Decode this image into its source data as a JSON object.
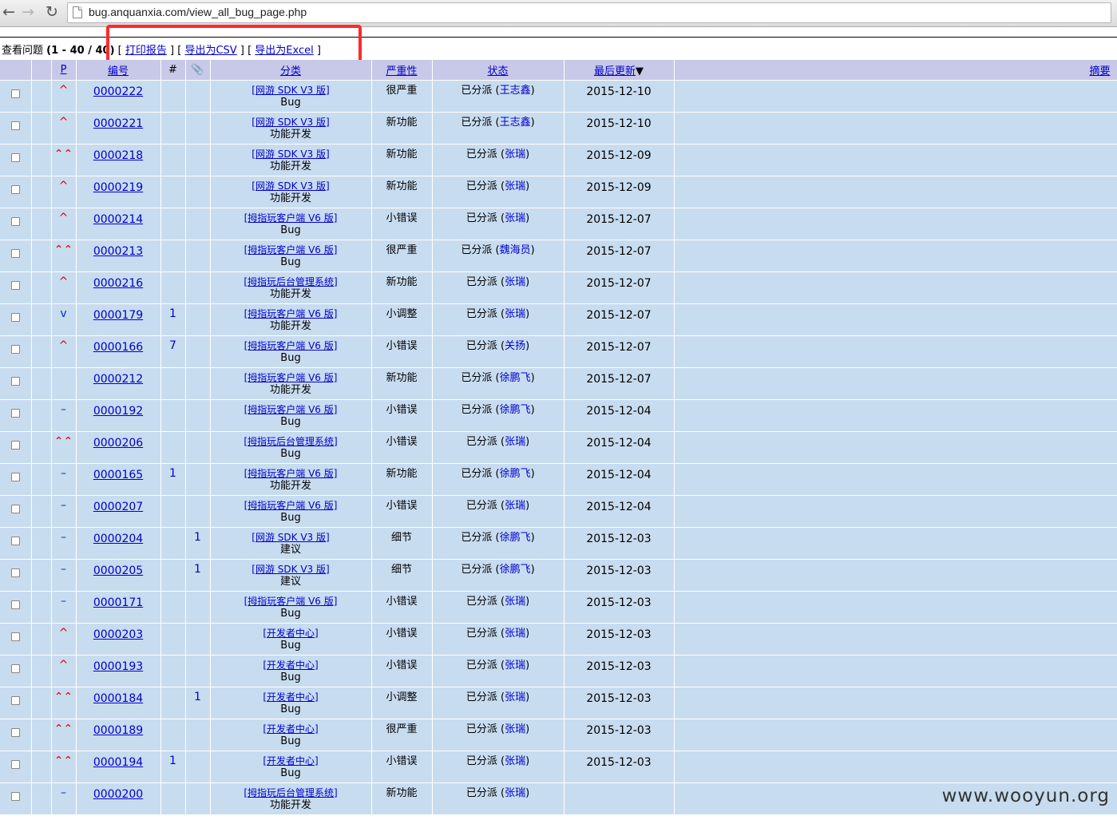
{
  "browser": {
    "url": "bug.anquanxia.com/view_all_bug_page.php",
    "back_icon": "back-arrow-icon",
    "forward_icon": "forward-arrow-icon",
    "reload_icon": "reload-icon"
  },
  "toolbar": {
    "label": "查看问题",
    "range": "(1 - 40 / 40)",
    "print": "打印报告",
    "csv": "导出为CSV",
    "excel": "导出为Excel",
    "bracket_open": "[",
    "bracket_close": "]"
  },
  "columns": {
    "p": "P",
    "id": "编号",
    "notes": "#",
    "attach": "📎",
    "category": "分类",
    "severity": "严重性",
    "status": "状态",
    "updated": "最后更新",
    "summary": "摘要"
  },
  "rows": [
    {
      "prio": "^",
      "id": "0000222",
      "notes": "",
      "attach": "",
      "cat": "[网游 SDK V3 版]",
      "sub": "Bug",
      "sev": "很严重",
      "st": "已分派",
      "who": "王志鑫",
      "date": "2015-12-10",
      "summary": ""
    },
    {
      "prio": "^",
      "id": "0000221",
      "notes": "",
      "attach": "",
      "cat": "[网游 SDK V3 版]",
      "sub": "功能开发",
      "sev": "新功能",
      "st": "已分派",
      "who": "王志鑫",
      "date": "2015-12-10",
      "summary": ""
    },
    {
      "prio": "⌃⌃",
      "id": "0000218",
      "notes": "",
      "attach": "",
      "cat": "[网游 SDK V3 版]",
      "sub": "功能开发",
      "sev": "新功能",
      "st": "已分派",
      "who": "张瑞",
      "date": "2015-12-09",
      "summary": ""
    },
    {
      "prio": "^",
      "id": "0000219",
      "notes": "",
      "attach": "",
      "cat": "[网游 SDK V3 版]",
      "sub": "功能开发",
      "sev": "新功能",
      "st": "已分派",
      "who": "张瑞",
      "date": "2015-12-09",
      "summary": ""
    },
    {
      "prio": "^",
      "id": "0000214",
      "notes": "",
      "attach": "",
      "cat": "[拇指玩客户端 V6 版]",
      "sub": "Bug",
      "sev": "小错误",
      "st": "已分派",
      "who": "张瑞",
      "date": "2015-12-07",
      "summary": ""
    },
    {
      "prio": "⌃⌃",
      "id": "0000213",
      "notes": "",
      "attach": "",
      "cat": "[拇指玩客户端 V6 版]",
      "sub": "Bug",
      "sev": "很严重",
      "st": "已分派",
      "who": "魏海员",
      "date": "2015-12-07",
      "summary": ""
    },
    {
      "prio": "^",
      "id": "0000216",
      "notes": "",
      "attach": "",
      "cat": "[拇指玩后台管理系统]",
      "sub": "功能开发",
      "sev": "新功能",
      "st": "已分派",
      "who": "张瑞",
      "date": "2015-12-07",
      "summary": ""
    },
    {
      "prio": "v",
      "id": "0000179",
      "notes": "1",
      "attach": "",
      "cat": "[拇指玩客户端 V6 版]",
      "sub": "功能开发",
      "sev": "小调整",
      "st": "已分派",
      "who": "张瑞",
      "date": "2015-12-07",
      "summary": ""
    },
    {
      "prio": "^",
      "id": "0000166",
      "notes": "7",
      "attach": "",
      "cat": "[拇指玩客户端 V6 版]",
      "sub": "Bug",
      "sev": "小错误",
      "st": "已分派",
      "who": "关扬",
      "date": "2015-12-07",
      "summary": ""
    },
    {
      "prio": "",
      "id": "0000212",
      "notes": "",
      "attach": "",
      "cat": "[拇指玩客户端 V6 版]",
      "sub": "功能开发",
      "sev": "新功能",
      "st": "已分派",
      "who": "徐鹏飞",
      "date": "2015-12-07",
      "summary": ""
    },
    {
      "prio": "–",
      "id": "0000192",
      "notes": "",
      "attach": "",
      "cat": "[拇指玩客户端 V6 版]",
      "sub": "Bug",
      "sev": "小错误",
      "st": "已分派",
      "who": "徐鹏飞",
      "date": "2015-12-04",
      "summary": ""
    },
    {
      "prio": "⌃⌃",
      "id": "0000206",
      "notes": "",
      "attach": "",
      "cat": "[拇指玩后台管理系统]",
      "sub": "Bug",
      "sev": "小错误",
      "st": "已分派",
      "who": "张瑞",
      "date": "2015-12-04",
      "summary": ""
    },
    {
      "prio": "–",
      "id": "0000165",
      "notes": "1",
      "attach": "",
      "cat": "[拇指玩客户端 V6 版]",
      "sub": "功能开发",
      "sev": "新功能",
      "st": "已分派",
      "who": "徐鹏飞",
      "date": "2015-12-04",
      "summary": ""
    },
    {
      "prio": "–",
      "id": "0000207",
      "notes": "",
      "attach": "",
      "cat": "[拇指玩客户端 V6 版]",
      "sub": "Bug",
      "sev": "小错误",
      "st": "已分派",
      "who": "张瑞",
      "date": "2015-12-04",
      "summary": ""
    },
    {
      "prio": "–",
      "id": "0000204",
      "notes": "",
      "attach": "1",
      "cat": "[网游 SDK V3 版]",
      "sub": "建议",
      "sev": "细节",
      "st": "已分派",
      "who": "徐鹏飞",
      "date": "2015-12-03",
      "summary": ""
    },
    {
      "prio": "–",
      "id": "0000205",
      "notes": "",
      "attach": "1",
      "cat": "[网游 SDK V3 版]",
      "sub": "建议",
      "sev": "细节",
      "st": "已分派",
      "who": "徐鹏飞",
      "date": "2015-12-03",
      "summary": ""
    },
    {
      "prio": "–",
      "id": "0000171",
      "notes": "",
      "attach": "",
      "cat": "[拇指玩客户端 V6 版]",
      "sub": "Bug",
      "sev": "小错误",
      "st": "已分派",
      "who": "张瑞",
      "date": "2015-12-03",
      "summary": ""
    },
    {
      "prio": "^",
      "id": "0000203",
      "notes": "",
      "attach": "",
      "cat": "[开发者中心]",
      "sub": "Bug",
      "sev": "小错误",
      "st": "已分派",
      "who": "张瑞",
      "date": "2015-12-03",
      "summary": ""
    },
    {
      "prio": "^",
      "id": "0000193",
      "notes": "",
      "attach": "",
      "cat": "[开发者中心]",
      "sub": "Bug",
      "sev": "小错误",
      "st": "已分派",
      "who": "张瑞",
      "date": "2015-12-03",
      "summary": ""
    },
    {
      "prio": "⌃⌃",
      "id": "0000184",
      "notes": "",
      "attach": "1",
      "cat": "[开发者中心]",
      "sub": "Bug",
      "sev": "小调整",
      "st": "已分派",
      "who": "张瑞",
      "date": "2015-12-03",
      "summary": ""
    },
    {
      "prio": "⌃⌃",
      "id": "0000189",
      "notes": "",
      "attach": "",
      "cat": "[开发者中心]",
      "sub": "Bug",
      "sev": "很严重",
      "st": "已分派",
      "who": "张瑞",
      "date": "2015-12-03",
      "summary": ""
    },
    {
      "prio": "⌃⌃",
      "id": "0000194",
      "notes": "1",
      "attach": "",
      "cat": "[开发者中心]",
      "sub": "Bug",
      "sev": "小错误",
      "st": "已分派",
      "who": "张瑞",
      "date": "2015-12-03",
      "summary": ""
    },
    {
      "prio": "–",
      "id": "0000200",
      "notes": "",
      "attach": "",
      "cat": "[拇指玩后台管理系统]",
      "sub": "功能开发",
      "sev": "新功能",
      "st": "已分派",
      "who": "张瑞",
      "date": "",
      "summary": ""
    }
  ],
  "watermark": "www.wooyun.org"
}
